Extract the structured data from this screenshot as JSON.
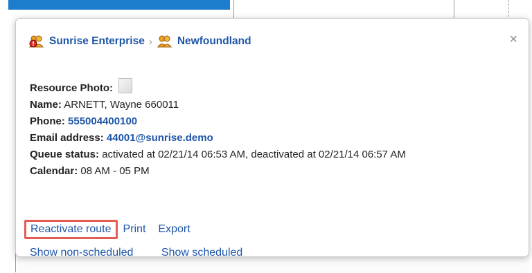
{
  "breadcrumb": {
    "parent": "Sunrise Enterprise",
    "separator": "›",
    "child": "Newfoundland"
  },
  "close_label": "×",
  "details": {
    "photo_label": "Resource Photo:",
    "name_label": "Name:",
    "name_value": "ARNETT, Wayne 660011",
    "phone_label": "Phone:",
    "phone_value": "555004400100",
    "email_label": "Email address:",
    "email_value": "44001@sunrise.demo",
    "queue_label": "Queue status:",
    "queue_value": "activated at 02/21/14 06:53 AM, deactivated at 02/21/14 06:57 AM",
    "calendar_label": "Calendar:",
    "calendar_value": "08 AM - 05 PM"
  },
  "actions": {
    "reactivate": "Reactivate route",
    "print": "Print",
    "export": "Export",
    "show_non_scheduled": "Show non-scheduled",
    "show_scheduled": "Show scheduled"
  },
  "colors": {
    "link": "#1f56a8",
    "highlight_border": "#e35d52",
    "icon_orange": "#f0a020",
    "icon_alert": "#d92a1c"
  },
  "icons": {
    "enterprise": "group-alert-icon",
    "child": "group-icon",
    "photo": "broken-image-icon",
    "close": "close-icon"
  }
}
